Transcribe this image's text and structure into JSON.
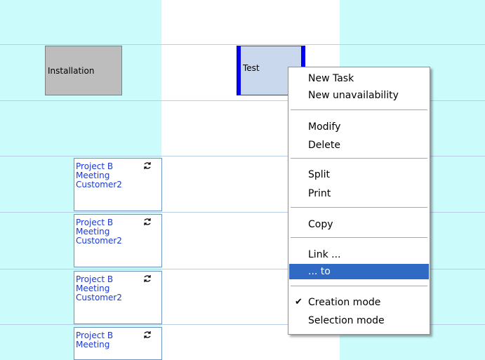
{
  "scheduler": {
    "tasks": {
      "installation": "Installation",
      "test": "Test"
    },
    "appointments": [
      {
        "line1": "Project B",
        "line2": "Meeting",
        "line3": "Customer2"
      },
      {
        "line1": "Project B",
        "line2": "Meeting",
        "line3": "Customer2"
      },
      {
        "line1": "Project B",
        "line2": "Meeting",
        "line3": "Customer2"
      },
      {
        "line1": "Project B",
        "line2": "Meeting",
        "line3": ""
      }
    ],
    "icons": {
      "recurrence": "recurrence-icon",
      "check": "checkmark-icon"
    }
  },
  "context_menu": {
    "new_task": "New Task",
    "new_unavailability": "New unavailability",
    "modify": "Modify",
    "delete": "Delete",
    "split": "Split",
    "print": "Print",
    "copy": "Copy",
    "link": "Link ...",
    "to": "... to",
    "creation_mode": "Creation mode",
    "selection_mode": "Selection mode",
    "check_mark": "✔",
    "highlight_color": "#316ac5"
  }
}
